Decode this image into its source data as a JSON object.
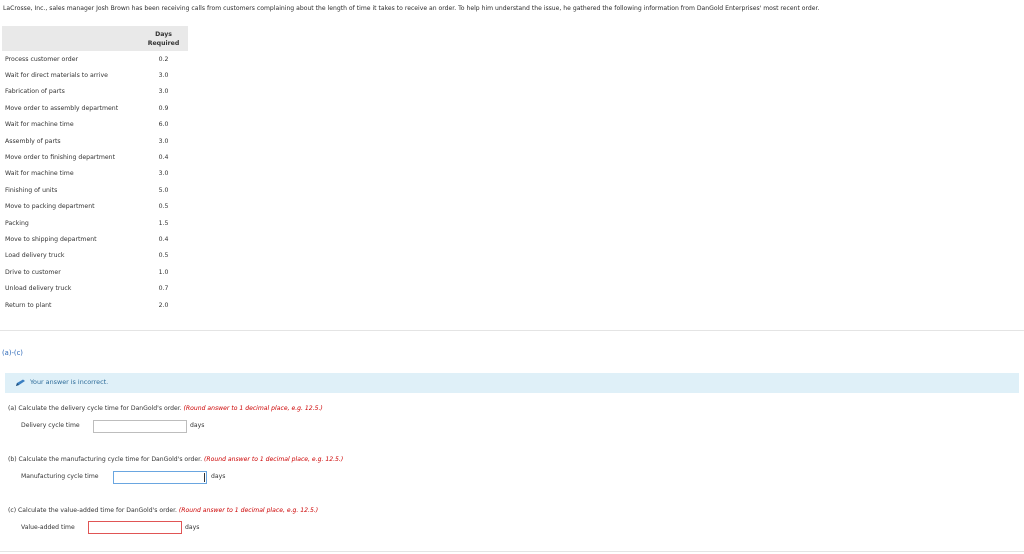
{
  "intro": "LaCrosse, Inc., sales manager Josh Brown has been receiving calls from customers complaining about the length of time it takes to receive an order. To help him understand the issue, he gathered the following information from DanGold Enterprises' most recent order.",
  "table": {
    "header_line1": "Days",
    "header_line2": "Required",
    "rows": [
      {
        "activity": "Process customer order",
        "days": "0.2"
      },
      {
        "activity": "Wait for direct materials to arrive",
        "days": "3.0"
      },
      {
        "activity": "Fabrication of parts",
        "days": "3.0"
      },
      {
        "activity": "Move order to assembly department",
        "days": "0.9"
      },
      {
        "activity": "Wait for machine time",
        "days": "6.0"
      },
      {
        "activity": "Assembly of parts",
        "days": "3.0"
      },
      {
        "activity": "Move order to finishing department",
        "days": "0.4"
      },
      {
        "activity": "Wait for machine time",
        "days": "3.0"
      },
      {
        "activity": "Finishing of units",
        "days": "5.0"
      },
      {
        "activity": "Move to packing department",
        "days": "0.5"
      },
      {
        "activity": "Packing",
        "days": "1.5"
      },
      {
        "activity": "Move to shipping department",
        "days": "0.4"
      },
      {
        "activity": "Load delivery truck",
        "days": "0.5"
      },
      {
        "activity": "Drive to customer",
        "days": "1.0"
      },
      {
        "activity": "Unload delivery truck",
        "days": "0.7"
      },
      {
        "activity": "Return to plant",
        "days": "2.0"
      }
    ]
  },
  "part_label": "(a)-(c)",
  "banner": {
    "message": "Your answer is incorrect."
  },
  "questions": {
    "a": {
      "text": "(a) Calculate the delivery cycle time for DanGold's order.",
      "hint": "(Round answer to 1 decimal place, e.g. 12.5.)",
      "field_label": "Delivery cycle time",
      "value": "",
      "unit": "days"
    },
    "b": {
      "text": "(b) Calculate the manufacturing cycle time for DanGold's order.",
      "hint": "(Round answer to 1 decimal place, e.g. 12.5.)",
      "field_label": "Manufacturing cycle time",
      "value": "",
      "unit": "days"
    },
    "c": {
      "text": "(c) Calculate the value-added time for DanGold's order.",
      "hint": "(Round answer to 1 decimal place, e.g. 12.5.)",
      "field_label": "Value-added time",
      "value": "",
      "unit": "days"
    }
  },
  "colors": {
    "link_blue": "#2a67b8",
    "banner_bg": "#dff0f8",
    "hint_red": "#cc0000",
    "error_border": "#e05555",
    "focus_border": "#6aa6e0"
  },
  "icons": {
    "banner": "pencil-icon"
  }
}
